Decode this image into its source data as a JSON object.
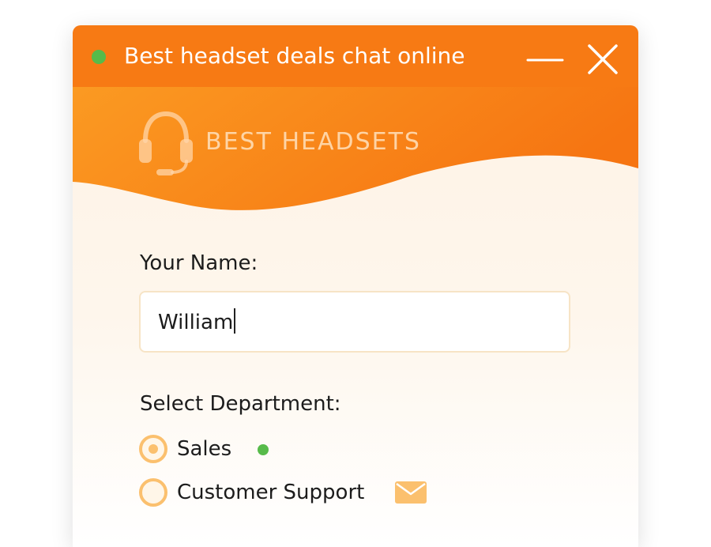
{
  "titlebar": {
    "title": "Best headset deals chat online",
    "status": "online",
    "status_color": "#57bb4a",
    "background_color": "#f77a14"
  },
  "brand": {
    "name": "BEST HEADSETS",
    "logo_icon": "headset-icon"
  },
  "form": {
    "name_label": "Your Name:",
    "name_value": "William",
    "department_label": "Select Department:",
    "departments": [
      {
        "label": "Sales",
        "selected": true,
        "status_icon": "online-dot-icon"
      },
      {
        "label": "Customer Support",
        "selected": false,
        "status_icon": "mail-icon"
      }
    ]
  },
  "colors": {
    "accent": "#f77a14",
    "radio": "#fbc06e",
    "online": "#57bb4a",
    "mail": "#fbc06e"
  }
}
